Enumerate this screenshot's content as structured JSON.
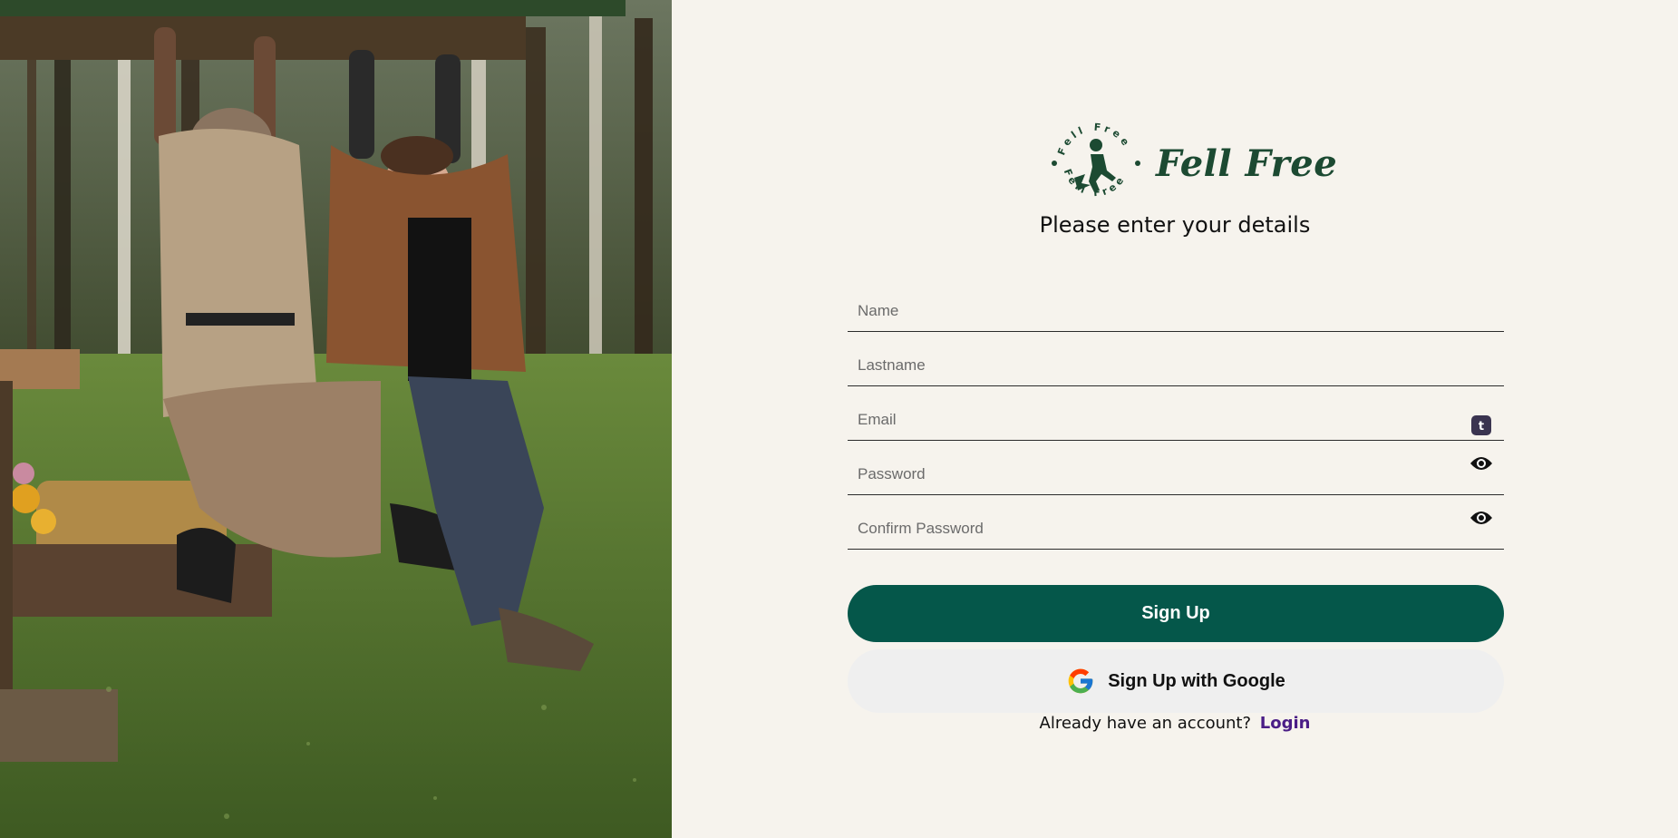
{
  "brand": {
    "name": "Fell Free",
    "badge_text": "Fell Free",
    "color": "#1c4a32"
  },
  "subtitle": "Please enter your details",
  "form": {
    "name_placeholder": "Name",
    "lastname_placeholder": "Lastname",
    "email_placeholder": "Email",
    "password_placeholder": "Password",
    "confirm_password_placeholder": "Confirm Password"
  },
  "icons": {
    "email_extension": "autofill-extension-icon",
    "password_toggle": "eye-icon",
    "confirm_password_toggle": "eye-icon",
    "google": "google-icon"
  },
  "buttons": {
    "signup_label": "Sign Up",
    "google_label": "Sign Up with Google"
  },
  "footer": {
    "prompt": "Already have an account?",
    "login_label": "Login"
  },
  "colors": {
    "primary": "#05574a",
    "link": "#4a1d86",
    "background": "#f6f3ed",
    "secondary_button": "#efefef"
  }
}
